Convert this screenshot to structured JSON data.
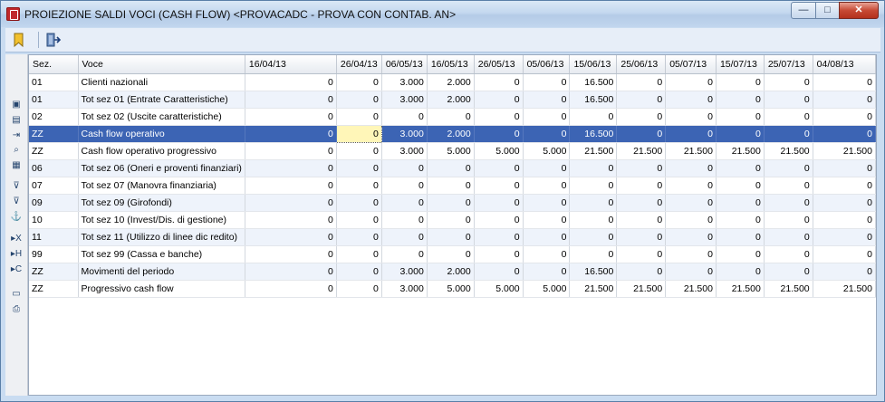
{
  "window": {
    "title": "PROIEZIONE SALDI VOCI (CASH FLOW) <PROVACADC - PROVA CON CONTAB. AN>",
    "minimize_label": "—",
    "maximize_label": "□",
    "close_label": "✕"
  },
  "toolbar": {
    "icons": [
      "bookmark-icon",
      "exit-door-icon"
    ]
  },
  "sidebar": {
    "icons": [
      "restore-icon",
      "list-icon",
      "import-icon",
      "zoom-icon",
      "calendar-icon",
      "filter-icon",
      "filter-remove-icon",
      "anchor-icon",
      "excel-export-icon",
      "html-export-icon",
      "calc-export-icon",
      "preview-icon",
      "print-icon"
    ]
  },
  "colors": {
    "selected_row": "#3c64b4",
    "current_cell": "#fff6b8",
    "alt_row": "#eef3fb"
  },
  "grid": {
    "columns": [
      "Sez.",
      "Voce",
      "16/04/13",
      "26/04/13",
      "06/05/13",
      "16/05/13",
      "26/05/13",
      "05/06/13",
      "15/06/13",
      "25/06/13",
      "05/07/13",
      "15/07/13",
      "25/07/13",
      "04/08/13"
    ],
    "rows": [
      [
        "01",
        "Clienti nazionali",
        "0",
        "0",
        "3.000",
        "2.000",
        "0",
        "0",
        "16.500",
        "0",
        "0",
        "0",
        "0",
        "0"
      ],
      [
        "01",
        "Tot sez 01 (Entrate Caratteristiche)",
        "0",
        "0",
        "3.000",
        "2.000",
        "0",
        "0",
        "16.500",
        "0",
        "0",
        "0",
        "0",
        "0"
      ],
      [
        "02",
        "Tot sez 02 (Uscite caratteristiche)",
        "0",
        "0",
        "0",
        "0",
        "0",
        "0",
        "0",
        "0",
        "0",
        "0",
        "0",
        "0"
      ],
      [
        "ZZ",
        "Cash flow operativo",
        "0",
        "0",
        "3.000",
        "2.000",
        "0",
        "0",
        "16.500",
        "0",
        "0",
        "0",
        "0",
        "0"
      ],
      [
        "ZZ",
        "Cash flow operativo progressivo",
        "0",
        "0",
        "3.000",
        "5.000",
        "5.000",
        "5.000",
        "21.500",
        "21.500",
        "21.500",
        "21.500",
        "21.500",
        "21.500"
      ],
      [
        "06",
        "Tot sez 06 (Oneri e proventi finanziari)",
        "0",
        "0",
        "0",
        "0",
        "0",
        "0",
        "0",
        "0",
        "0",
        "0",
        "0",
        "0"
      ],
      [
        "07",
        "Tot sez 07 (Manovra finanziaria)",
        "0",
        "0",
        "0",
        "0",
        "0",
        "0",
        "0",
        "0",
        "0",
        "0",
        "0",
        "0"
      ],
      [
        "09",
        "Tot sez 09 (Girofondi)",
        "0",
        "0",
        "0",
        "0",
        "0",
        "0",
        "0",
        "0",
        "0",
        "0",
        "0",
        "0"
      ],
      [
        "10",
        "Tot sez 10 (Invest/Dis. di gestione)",
        "0",
        "0",
        "0",
        "0",
        "0",
        "0",
        "0",
        "0",
        "0",
        "0",
        "0",
        "0"
      ],
      [
        "11",
        "Tot sez 11 (Utilizzo di linee dic redito)",
        "0",
        "0",
        "0",
        "0",
        "0",
        "0",
        "0",
        "0",
        "0",
        "0",
        "0",
        "0"
      ],
      [
        "99",
        "Tot sez 99 (Cassa e banche)",
        "0",
        "0",
        "0",
        "0",
        "0",
        "0",
        "0",
        "0",
        "0",
        "0",
        "0",
        "0"
      ],
      [
        "ZZ",
        "Movimenti del periodo",
        "0",
        "0",
        "3.000",
        "2.000",
        "0",
        "0",
        "16.500",
        "0",
        "0",
        "0",
        "0",
        "0"
      ],
      [
        "ZZ",
        "Progressivo cash flow",
        "0",
        "0",
        "3.000",
        "5.000",
        "5.000",
        "5.000",
        "21.500",
        "21.500",
        "21.500",
        "21.500",
        "21.500",
        "21.500"
      ]
    ],
    "selected_row": 3,
    "current_cell_column": 3
  }
}
